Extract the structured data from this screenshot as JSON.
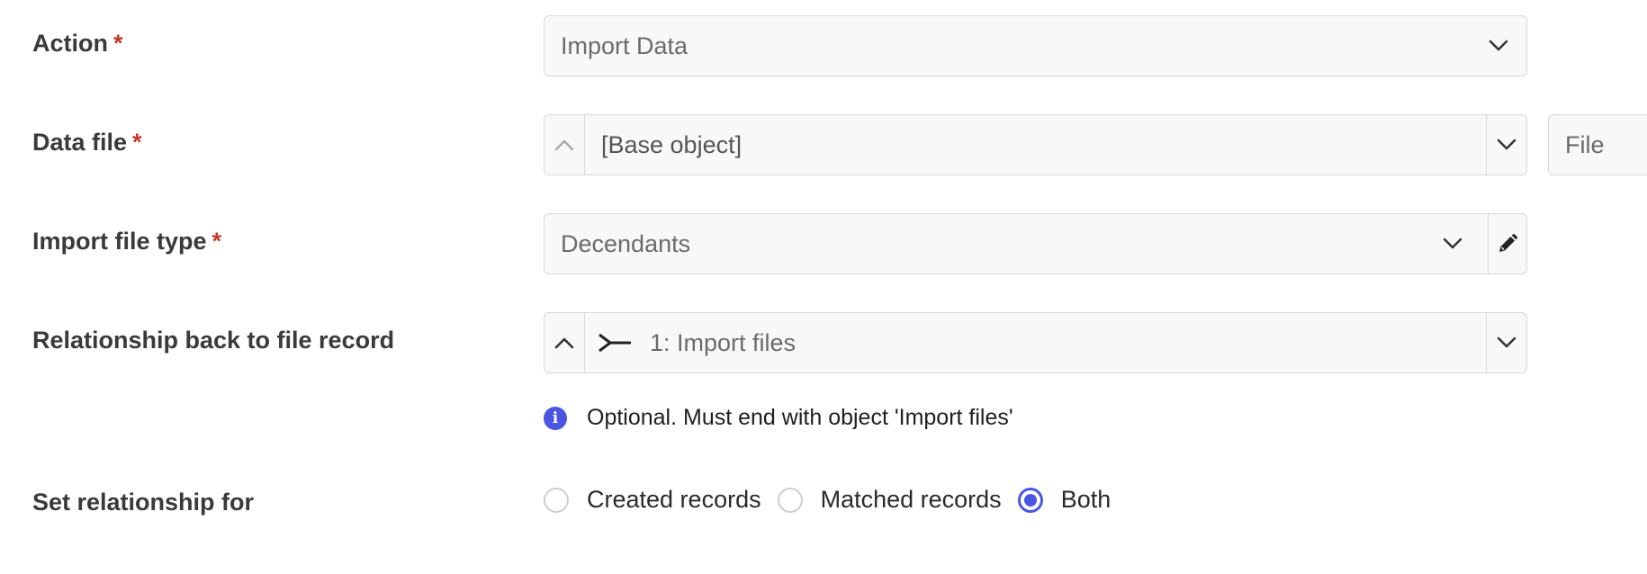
{
  "fields": {
    "action": {
      "label": "Action",
      "required_marker": "*",
      "value": "Import Data"
    },
    "data_file": {
      "label": "Data file",
      "required_marker": "*",
      "value": "[Base object]",
      "secondary_placeholder": "File"
    },
    "import_file_type": {
      "label": "Import file type",
      "required_marker": "*",
      "value": "Decendants"
    },
    "relationship": {
      "label": "Relationship back to file record",
      "value": "1: Import files",
      "hint": "Optional. Must end with object 'Import files'"
    },
    "set_relationship_for": {
      "label": "Set relationship for",
      "options": [
        "Created records",
        "Matched records",
        "Both"
      ],
      "selected": "Both"
    }
  },
  "icons": {
    "info": "info-icon",
    "pencil": "pencil-icon",
    "relationship": "relationship-arrow-icon",
    "chevron_down": "chevron-down-icon",
    "chevron_up": "chevron-up-icon"
  },
  "colors": {
    "accent": "#4a56e2",
    "required": "#c0392b",
    "border": "#d9d9d9",
    "field_bg": "#f8f8f8"
  }
}
